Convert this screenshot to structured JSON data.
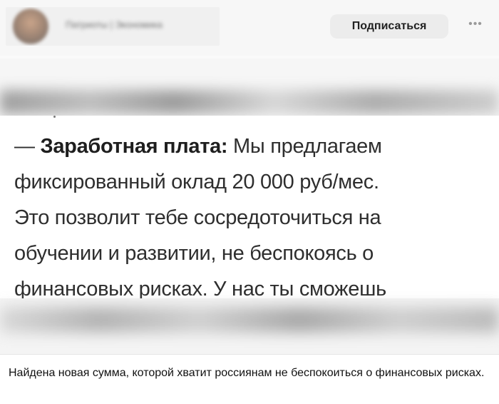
{
  "header": {
    "channel_name": "Патриоты | Экономика",
    "subscribe_label": "Подписаться",
    "more_icon": "ellipsis-icon"
  },
  "post_image": {
    "lead": "Заработная плата:",
    "line1_rest": " Мы предлагаем",
    "line2": "фиксированный оклад 20 000 руб/мес.",
    "line3": "Это позволит тебе сосредоточиться на",
    "line4": "обучении и развитии, не беспокоясь о",
    "line5": "финансовых рисках. У нас ты сможешь"
  },
  "caption": "Найдена новая сумма, которой хватит россиянам не беспокоиться о финансовых рисках.",
  "colors": {
    "background": "#ffffff",
    "button_bg": "#ececec",
    "text": "#111111"
  }
}
